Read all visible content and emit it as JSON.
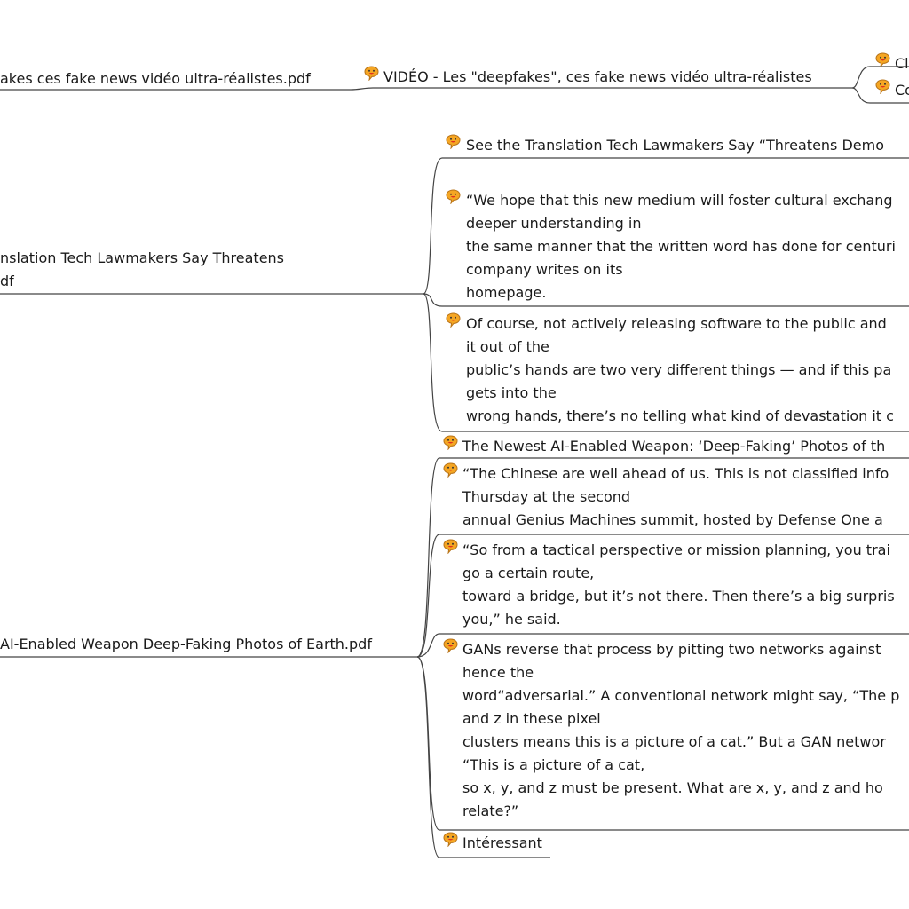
{
  "branches": [
    {
      "id": "b1",
      "label": "akes ces fake news vidéo ultra-réalistes.pdf"
    },
    {
      "id": "b2",
      "label": "nslation Tech Lawmakers Say Threatens\ndf"
    },
    {
      "id": "b3",
      "label": "AI-Enabled Weapon Deep-Faking Photos of Earth.pdf"
    }
  ],
  "topics": {
    "video_title": "VIDÉO - Les \"deepfakes\", ces fake news vidéo ultra-réalistes",
    "ch": "Cl",
    "co": "Co",
    "t1": "See the Translation Tech Lawmakers Say “Threatens Demo",
    "t2": "“We hope that this new medium will foster cultural exchang\ndeeper understanding in\nthe same manner that the written word has done for centuri\ncompany writes on its\nhomepage.",
    "t3": "Of course, not actively releasing software to the public and\nit out of the\npublic’s hands are two very different things — and if this pa\ngets into the\nwrong hands, there’s no telling what kind of devastation it c",
    "t4": "The Newest AI-Enabled Weapon: ‘Deep-Faking’ Photos of th",
    "t5": "“The Chinese are well ahead of us. This is not classified info\nThursday at the second\nannual Genius Machines summit, hosted by Defense One a",
    "t6": "“So from a tactical perspective or mission planning, you trai\ngo a certain route,\ntoward a bridge, but it’s not there. Then there’s a big surpris\nyou,” he said.",
    "t7": "GANs reverse that process by pitting two networks against \nhence the\nword“adversarial.” A conventional network might say, “The p\nand z in these pixel\nclusters means this is a picture of a cat.” But a GAN networ\n“This is a picture of a cat,\nso x, y, and z must be present. What are x, y, and z and ho\nrelate?”",
    "t8": "Intéressant"
  },
  "icons": {
    "note": "speech-bubble-icon"
  },
  "colors": {
    "line": "#444444",
    "bubble_fill": "#f5a623",
    "bubble_stroke": "#b8741a",
    "bubble_mouth": "#e0301e"
  }
}
